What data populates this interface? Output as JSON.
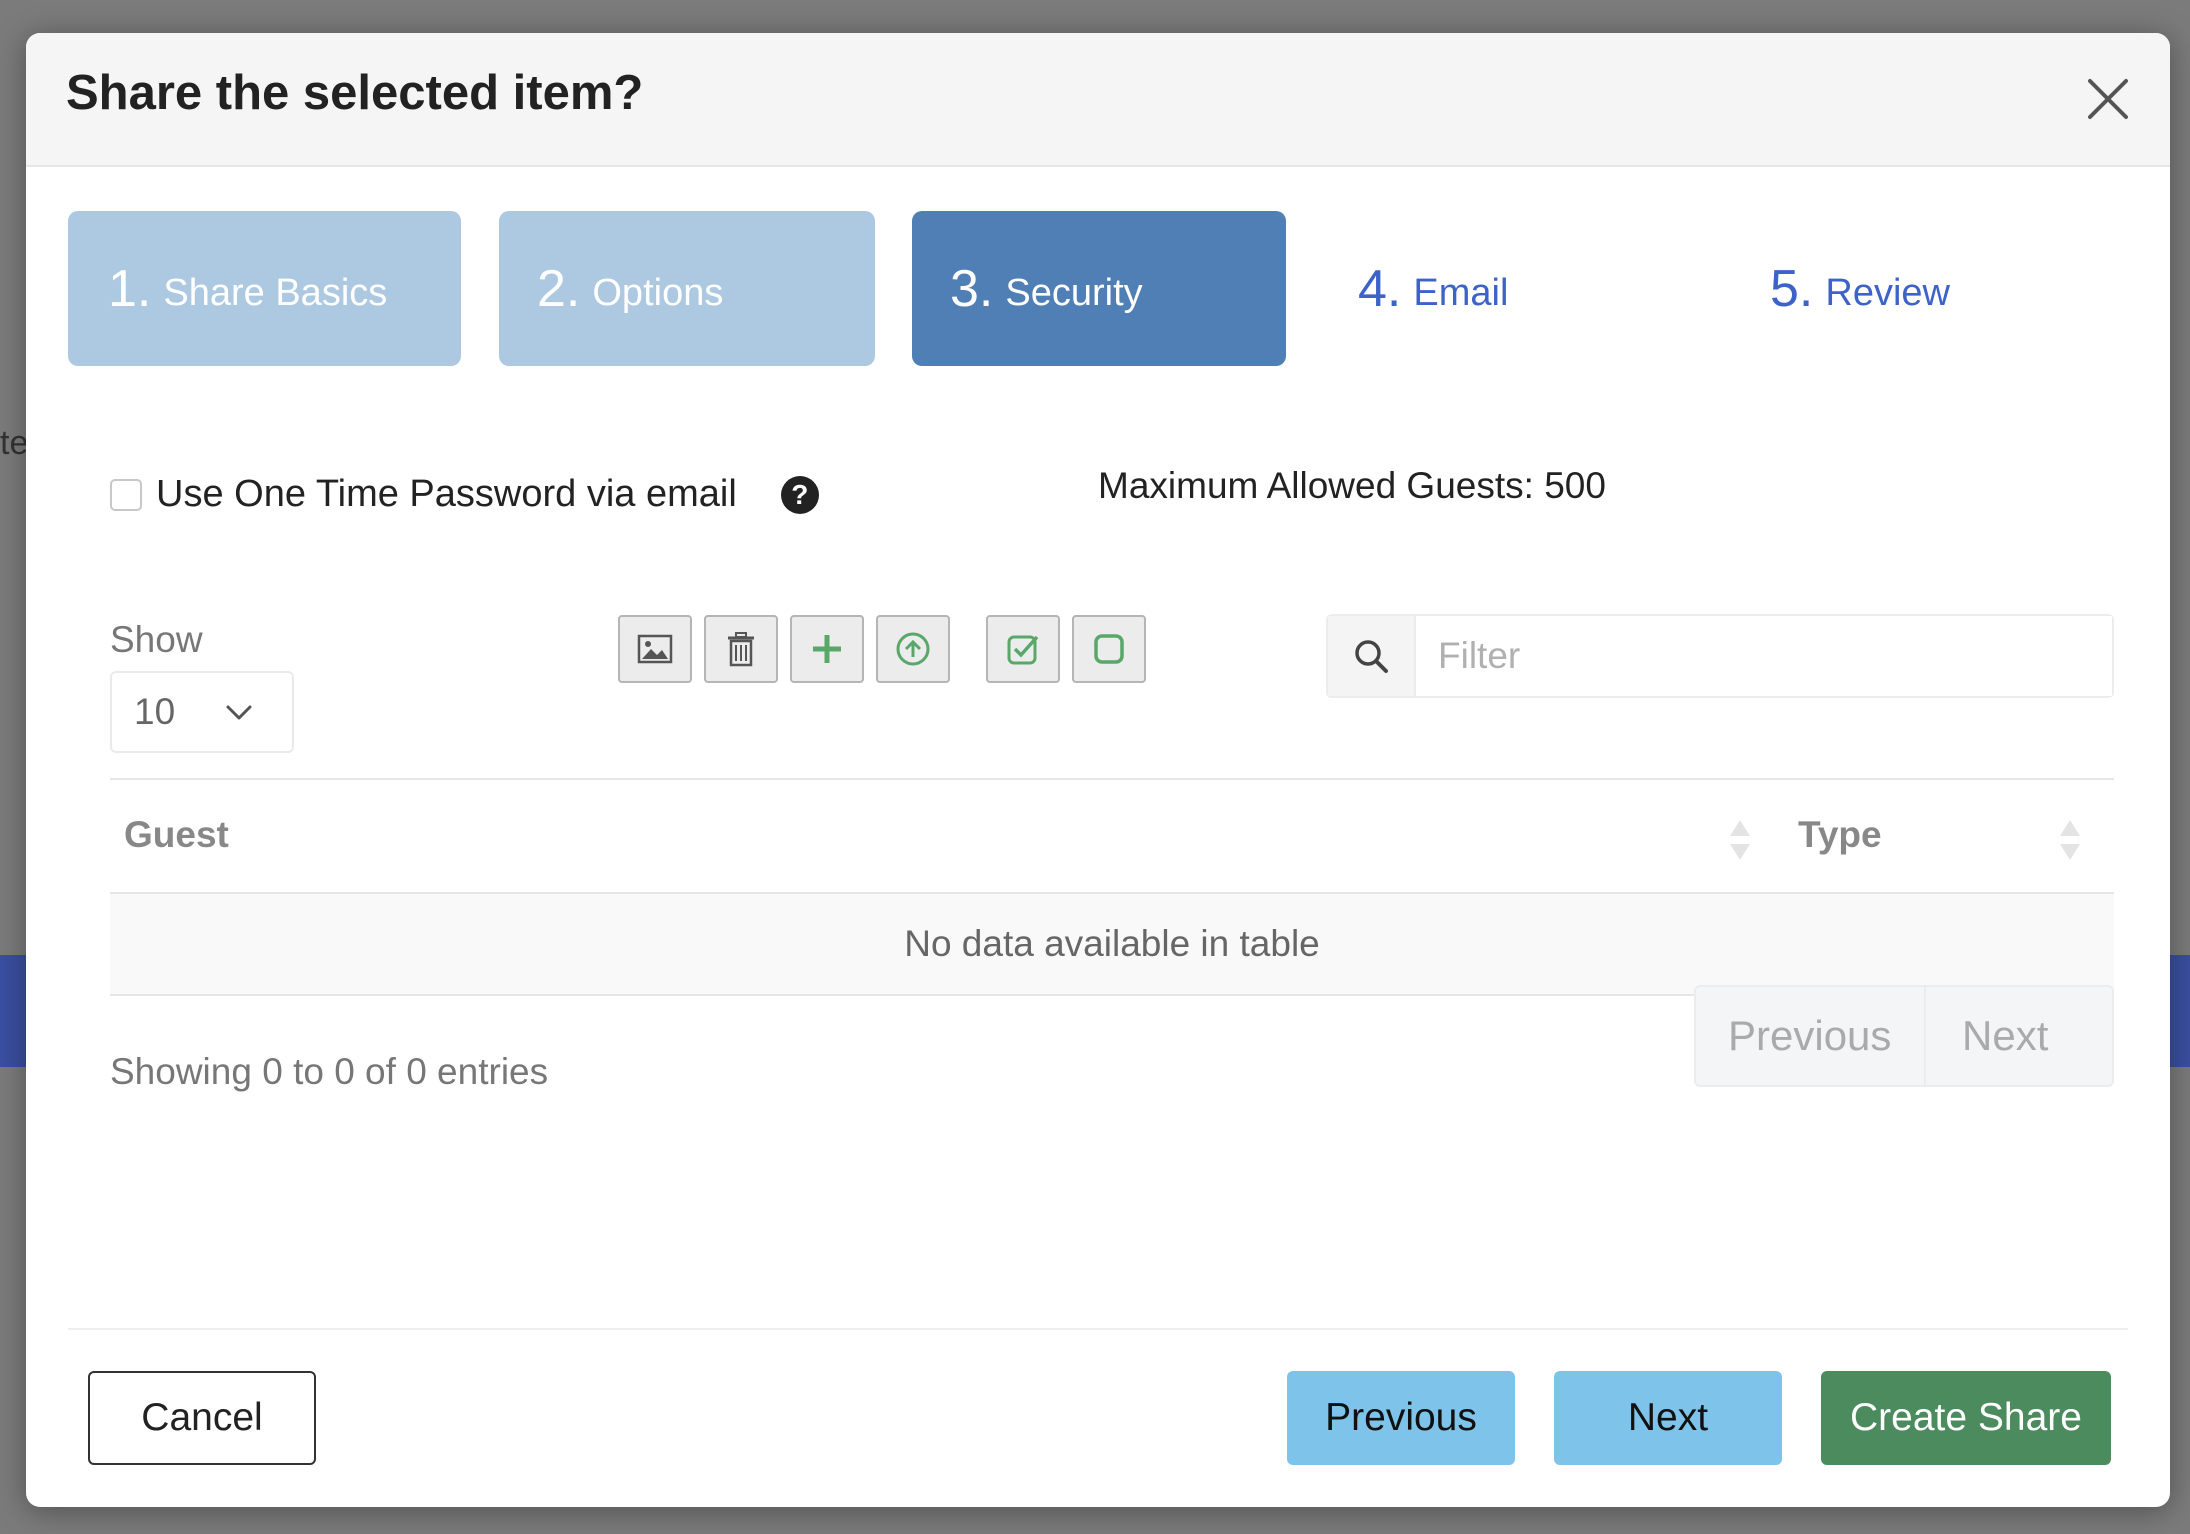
{
  "background": {
    "fragment_text": "te"
  },
  "modal": {
    "title": "Share the selected item?"
  },
  "steps": [
    {
      "num": "1.",
      "label": "Share Basics",
      "state": "done"
    },
    {
      "num": "2.",
      "label": "Options",
      "state": "done"
    },
    {
      "num": "3.",
      "label": "Security",
      "state": "active"
    },
    {
      "num": "4.",
      "label": "Email",
      "state": "todo"
    },
    {
      "num": "5.",
      "label": "Review",
      "state": "todo"
    }
  ],
  "security": {
    "otp_label": "Use One Time Password via email",
    "otp_checked": false,
    "help_glyph": "?",
    "max_guests_text": "Maximum Allowed Guests: 500"
  },
  "table_controls": {
    "show_label": "Show",
    "show_value": "10",
    "filter_placeholder": "Filter",
    "toolbar_icons": [
      "image-icon",
      "trash-icon",
      "plus-icon",
      "upload-circle-icon",
      "check-square-icon",
      "square-icon"
    ]
  },
  "table": {
    "columns": [
      "Guest",
      "Type"
    ],
    "empty_message": "No data available in table",
    "info": "Showing 0 to 0 of 0 entries",
    "pager_previous": "Previous",
    "pager_next": "Next"
  },
  "footer": {
    "cancel": "Cancel",
    "previous": "Previous",
    "next": "Next",
    "create": "Create Share"
  },
  "colors": {
    "step_done": "#adc8e1",
    "step_active": "#4f7fb5",
    "step_todo_text": "#3d63c9",
    "nav_button": "#7ec3ea",
    "create_button": "#4b8b5e",
    "toolbar_icon_green": "#5aa76a"
  }
}
